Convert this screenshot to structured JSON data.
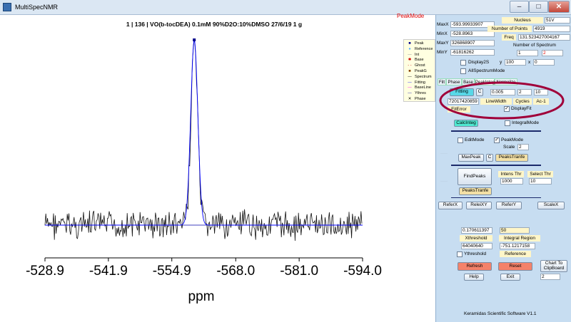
{
  "window": {
    "title": "MultiSpecNMR",
    "min": "–",
    "max": "□",
    "close": "✕"
  },
  "plot": {
    "title": "1 | 136 | VO(b-tocDEA) 0.1mM 90%D2O:10%DMSO 27/6/19 1 g",
    "mode": "PeakMode",
    "xlabel": "ppm"
  },
  "chart_data": {
    "type": "line",
    "title": "1 | 136 | VO(b-tocDEA) 0.1mM 90%D2O:10%DMSO 27/6/19 1 g",
    "xlabel": "ppm",
    "ylabel": "",
    "xlim": [
      -528.9,
      -594.0
    ],
    "x_ticks": [
      "-528.9",
      "-541.9",
      "-554.9",
      "-568.0",
      "-581.0",
      "-594.0"
    ],
    "series": [
      {
        "name": "Spectrum",
        "style": "noisy line",
        "color": "#000000",
        "peak_x": -559.5,
        "peak_y": 1.0,
        "baseline_y": 0.0
      },
      {
        "name": "Fitting",
        "style": "smooth line",
        "color": "#0000ff",
        "peak_x": -559.5,
        "peak_y": 1.0
      },
      {
        "name": "Peak",
        "style": "marker",
        "color": "#0000aa",
        "x": -559.5,
        "y": 1.0
      }
    ]
  },
  "legend": {
    "items": [
      {
        "label": "Peak",
        "symbol": "■",
        "color": "#00008b"
      },
      {
        "label": "Reference",
        "symbol": "●",
        "color": "#55aaff"
      },
      {
        "label": "Int",
        "symbol": "—",
        "color": "#888888"
      },
      {
        "label": "Base",
        "symbol": "✱",
        "color": "#cc0000"
      },
      {
        "label": "Ghost",
        "symbol": "- -",
        "color": "#cc0000"
      },
      {
        "label": "PeakG",
        "symbol": "■",
        "color": "#884400"
      },
      {
        "label": "Spectrum",
        "symbol": "—",
        "color": "#000000"
      },
      {
        "label": "Fitting",
        "symbol": "—",
        "color": "#0000ff"
      },
      {
        "label": "BaseLine",
        "symbol": "—",
        "color": "#ff00ff"
      },
      {
        "label": "Ythres",
        "symbol": "—",
        "color": "#0000aa"
      },
      {
        "label": "Phase",
        "symbol": "✕",
        "color": "#000000"
      }
    ]
  },
  "panel": {
    "maxx_label": "MaxX",
    "maxx": "-593.99933907",
    "minx_label": "MinX",
    "minx": "-528.8963",
    "maxy_label": "MaxY",
    "maxy": "326868907",
    "miny_label": "MinY",
    "miny": "-61816262",
    "nucleus_label": "Nucleus",
    "nucleus": "51V",
    "npoints_label": "Number of Points",
    "npoints": "4919",
    "freq_label": "Freq",
    "freq": "131.523427004167",
    "nspec_label": "Number of Spectrum",
    "nspec_a": "1",
    "nspec_b": "2",
    "display2s": "Display2S",
    "y_label": "y",
    "y_value": "100",
    "x_label": "x",
    "x_value": "0",
    "allspectrum": "AllSpectrumMode",
    "tabs": [
      "Filt",
      "Phase",
      "Base",
      "PeakInteg",
      "Normalize"
    ],
    "fitting_btn": "Fitting",
    "c_btn": "C",
    "fit_a": "0.005",
    "fit_b": "2",
    "fit_c": "10",
    "fit_value": "72017420859",
    "linewidth": "LineWidth",
    "cycles": "Cycles",
    "ac": "Ac-1",
    "fiterror": "FitError",
    "displayfit": "DisplayFit",
    "calcinteg": "CalcInteg",
    "integralmode": "IntegralMode",
    "editmode": "EditMode",
    "peakmode": "PeakMode",
    "scale_label": "Scale",
    "scale_value": "2",
    "maxpeak": "MaxPeak",
    "c2": "C",
    "peakstranfe": "PeaksTranfe",
    "findpeaks": "FindPeaks",
    "intens_thr_label": "Intens Thr",
    "intens_thr": "1000",
    "select_thr_label": "Select Thr",
    "select_thr": "10",
    "peakstranfe2": "PeaksTranfe",
    "referx": "ReferX",
    "releixy": "ReleiXY",
    "refery": "ReferY",
    "scalex": "ScaleX",
    "val1": "0.170611397",
    "val2": "50",
    "xthreshold": "Xthreshold",
    "integral_region": "Integral Region",
    "val3": "64040640",
    "val4": "-751.1217158",
    "ythreshold": "Ythreshold",
    "reference": "Reference",
    "refresh": "Refresh",
    "reset": "Reset",
    "chart_to_clipboard": "Chart To ClipBoard",
    "help": "Help",
    "exit": "Exit",
    "clip_value": "2",
    "footer": "Keramidas Scientific Software V1.1"
  }
}
